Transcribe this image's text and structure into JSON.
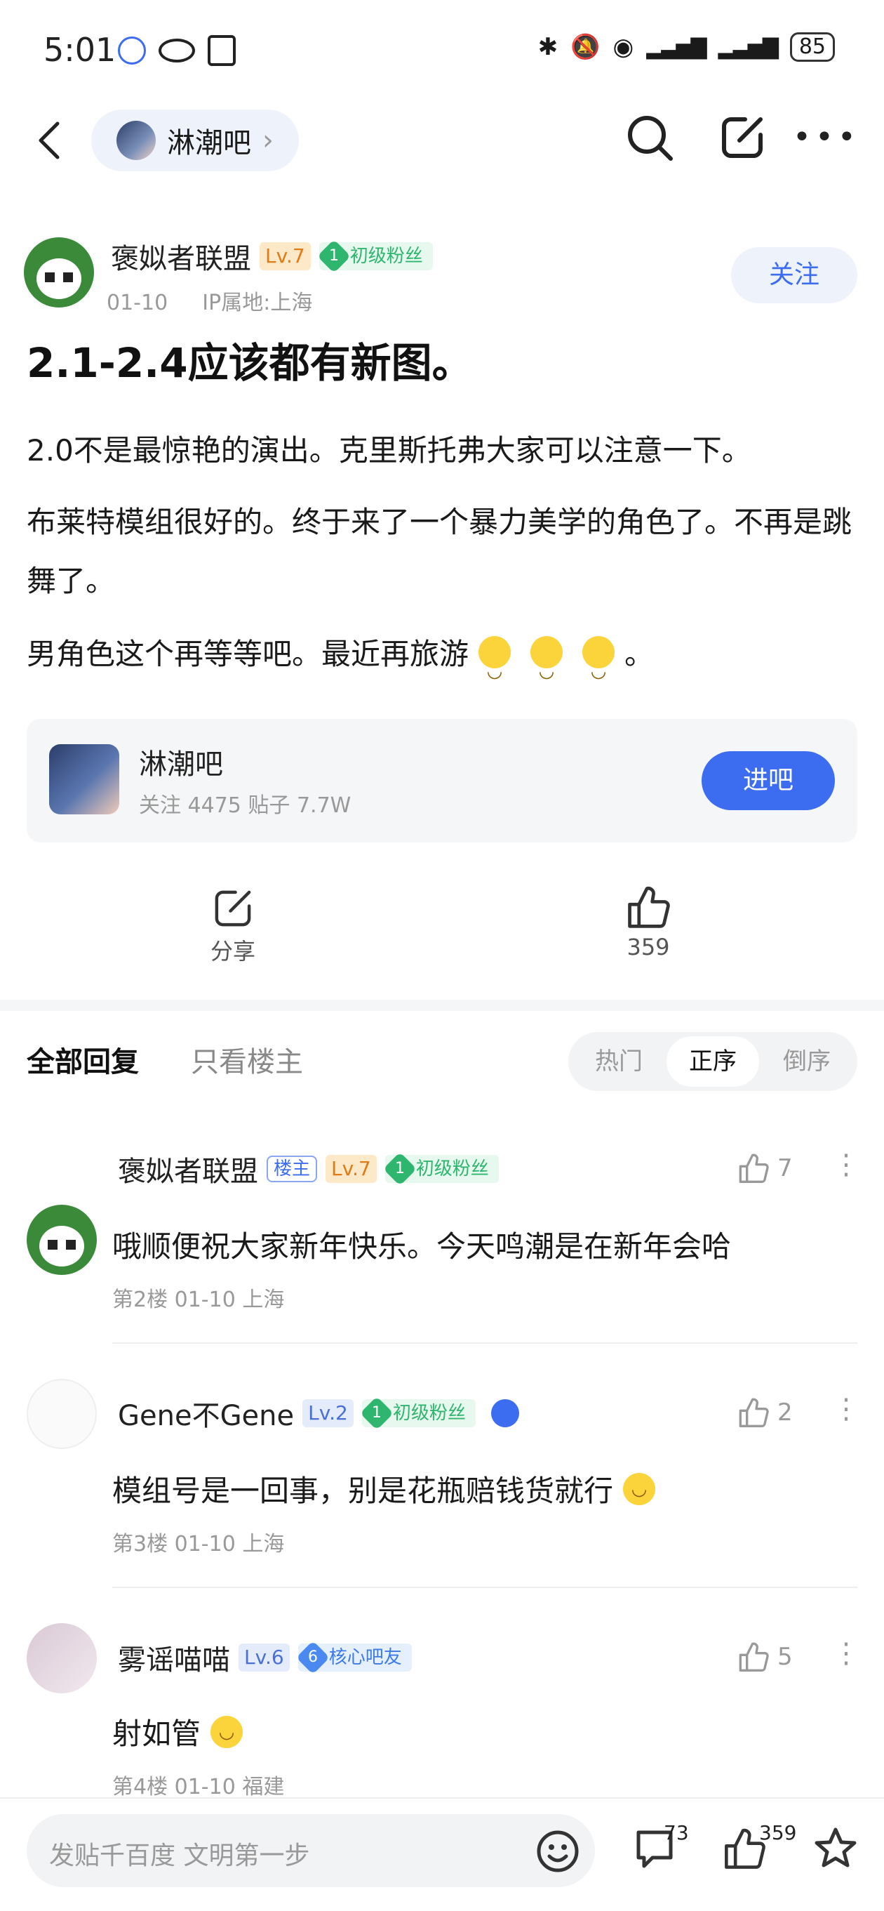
{
  "status": {
    "time": "5:01",
    "battery": "85"
  },
  "nav": {
    "forum_name": "淋潮吧"
  },
  "post": {
    "author": "褒姒者联盟",
    "level": "Lv.7",
    "fan_level": "1",
    "fan_title": "初级粉丝",
    "date": "01-10",
    "ip": "IP属地:上海",
    "follow_label": "关注",
    "title": "2.1-2.4应该都有新图。",
    "paragraphs": [
      "2.0不是最惊艳的演出。克里斯托弗大家可以注意一下。",
      "布莱特模组很好的。终于来了一个暴力美学的角色了。不再是跳舞了。",
      "男角色这个再等等吧。最近再旅游"
    ],
    "para3_end": "。"
  },
  "forum_card": {
    "name": "淋潮吧",
    "stats": "关注 4475  贴子 7.7W",
    "enter_label": "进吧"
  },
  "actions": {
    "share_label": "分享",
    "like_count": "359"
  },
  "tabs": {
    "all_replies": "全部回复",
    "owner_only": "只看楼主",
    "hot": "热门",
    "asc": "正序",
    "desc": "倒序"
  },
  "comments": [
    {
      "name": "褒姒者联盟",
      "owner_tag": "楼主",
      "level": "Lv.7",
      "fan_level": "1",
      "fan_title": "初级粉丝",
      "likes": "7",
      "text": "哦顺便祝大家新年快乐。今天鸣潮是在新年会哈",
      "meta": "第2楼  01-10  上海"
    },
    {
      "name": "Gene不Gene",
      "level": "Lv.2",
      "fan_level": "1",
      "fan_title": "初级粉丝",
      "likes": "2",
      "text": "模组号是一回事，别是花瓶赔钱货就行",
      "meta": "第3楼  01-10  上海"
    },
    {
      "name": "雾谣喵喵",
      "level": "Lv.6",
      "fan_level": "6",
      "fan_title": "核心吧友",
      "likes": "5",
      "text": "射如管",
      "meta": "第4楼  01-10  福建"
    }
  ],
  "bottom": {
    "input_placeholder": "发贴千百度 文明第一步",
    "comment_count": "73",
    "like_count": "359"
  },
  "colors": {
    "accent": "#3c6cf0",
    "fan_green": "#2fb66e",
    "fan_blue": "#4a8af0",
    "lv_orange": "#f6a23a"
  }
}
